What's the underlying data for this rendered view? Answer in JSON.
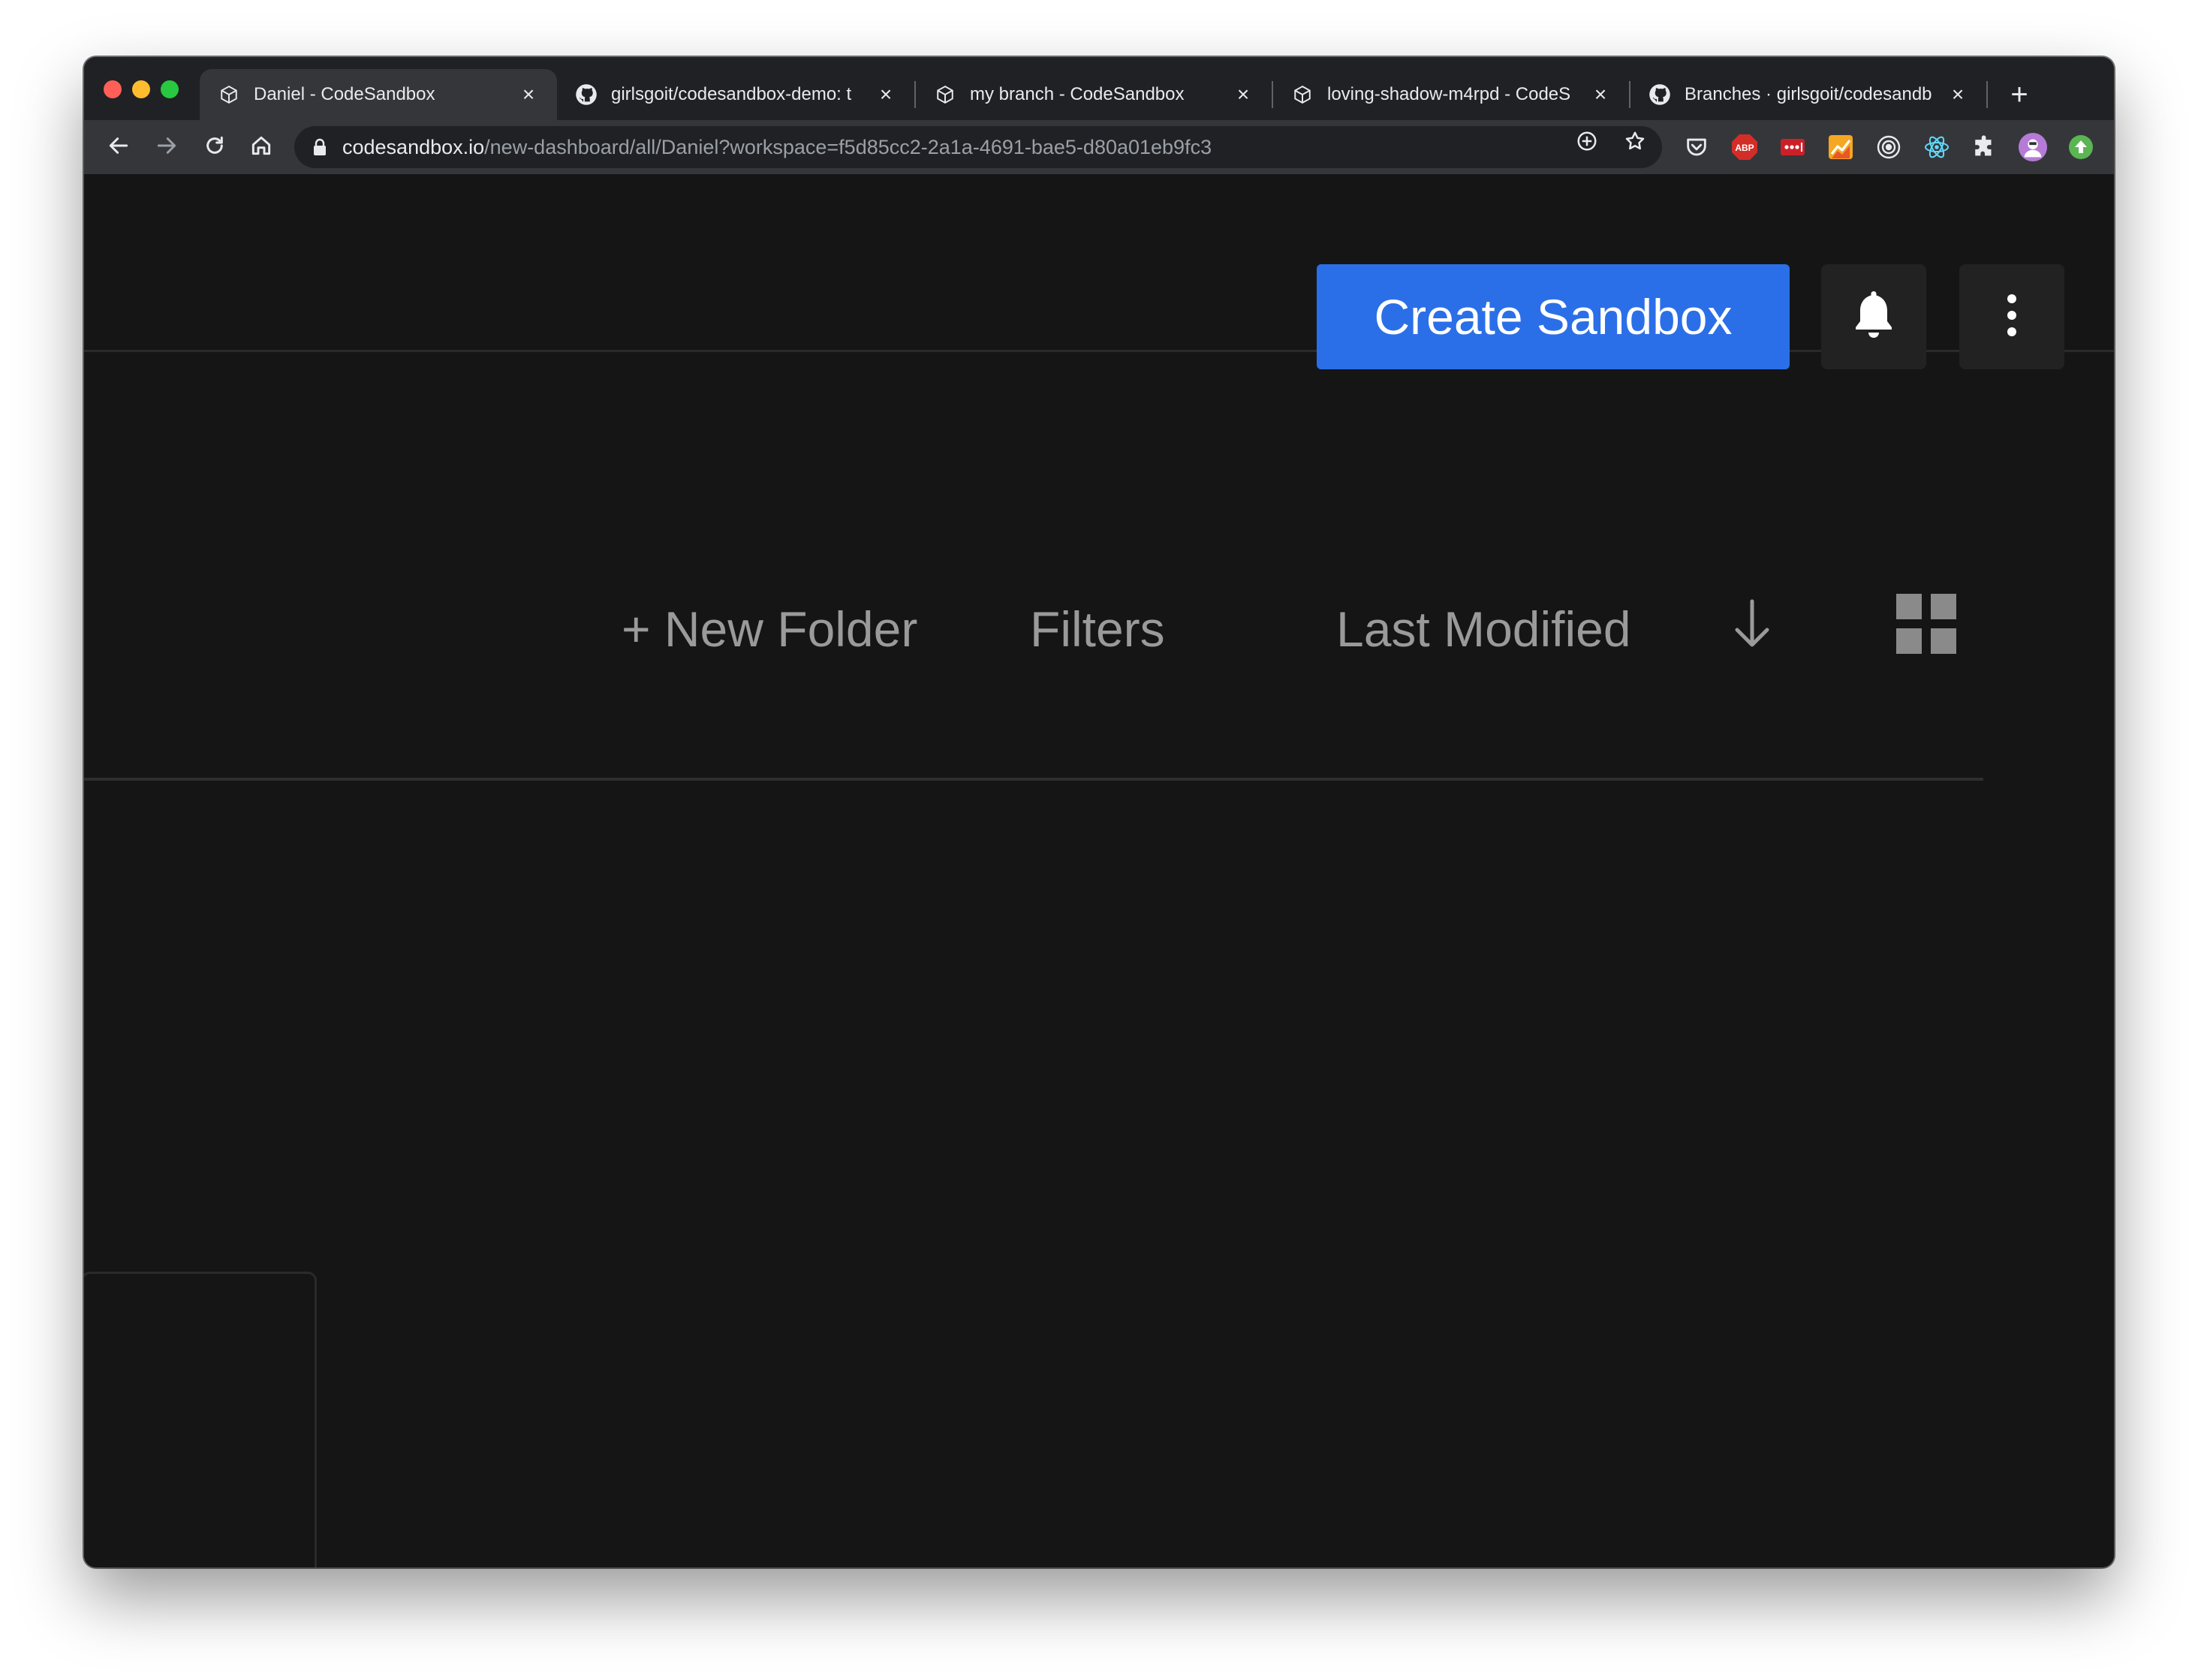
{
  "browser": {
    "tabs": [
      {
        "title": "Daniel - CodeSandbox",
        "icon": "codesandbox-icon",
        "active": true,
        "close": "×"
      },
      {
        "title": "girlsgoit/codesandbox-demo: t",
        "icon": "github-icon",
        "active": false,
        "close": "×"
      },
      {
        "title": "my branch - CodeSandbox",
        "icon": "codesandbox-icon",
        "active": false,
        "close": "×"
      },
      {
        "title": "loving-shadow-m4rpd - CodeS",
        "icon": "codesandbox-icon",
        "active": false,
        "close": "×"
      },
      {
        "title": "Branches · girlsgoit/codesandb",
        "icon": "github-icon",
        "active": false,
        "close": "×"
      }
    ],
    "new_tab": "+",
    "url_host": "codesandbox.io",
    "url_path": "/new-dashboard/all/Daniel?workspace=f5d85cc2-2a1a-4691-bae5-d80a01eb9fc3",
    "extensions": [
      "pocket-icon",
      "adblock-plus-icon",
      "lastpass-icon",
      "analytics-icon",
      "target-icon",
      "react-devtools-icon",
      "puzzle-extensions-icon",
      "profile-avatar",
      "upload-extension-icon"
    ],
    "adblock_label": "ABP"
  },
  "dashboard": {
    "create_label": "Create Sandbox",
    "new_folder_label": "+ New Folder",
    "filters_label": "Filters",
    "sort_label": "Last Modified",
    "sort_direction_icon": "arrow-down-icon",
    "view_icon": "grid-view-icon",
    "notification_icon": "bell-icon",
    "menu_icon": "more-vertical-icon"
  },
  "colors": {
    "accent": "#2b6fe8",
    "background": "#151516",
    "muted_text": "#9a9a9a"
  }
}
